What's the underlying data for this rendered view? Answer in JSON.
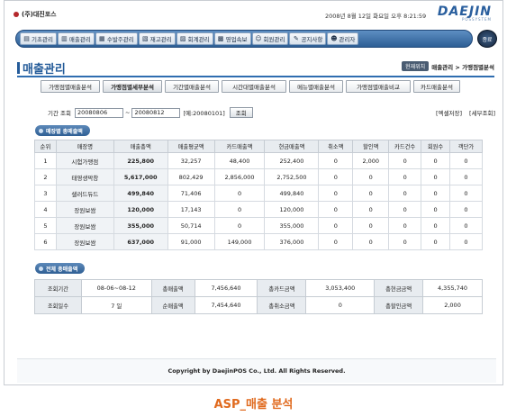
{
  "header": {
    "company": "(주)대진포스",
    "datetime": "2008년 8월 12일 화요일 오후 8:21:59",
    "logo_text": "DAEJIN",
    "logo_sub": "POSSYSTEM"
  },
  "nav": {
    "items": [
      {
        "label": "기초관리",
        "icon": "folder-icon",
        "glyph": "▤"
      },
      {
        "label": "매출관리",
        "icon": "chart-icon",
        "glyph": "▥"
      },
      {
        "label": "수발주관리",
        "icon": "truck-icon",
        "glyph": "▦"
      },
      {
        "label": "재고관리",
        "icon": "box-icon",
        "glyph": "▧"
      },
      {
        "label": "회계관리",
        "icon": "calculator-icon",
        "glyph": "▨"
      },
      {
        "label": "영업속보",
        "icon": "news-icon",
        "glyph": "▩"
      },
      {
        "label": "회원관리",
        "icon": "users-icon",
        "glyph": "☺"
      },
      {
        "label": "공지사항",
        "icon": "megaphone-icon",
        "glyph": "✎"
      },
      {
        "label": "관리자",
        "icon": "admin-icon",
        "glyph": "☻"
      }
    ],
    "logout": "종료"
  },
  "page": {
    "title": "매출관리",
    "location_badge": "현재위치",
    "location_path": "매출관리 > 가맹점별분석"
  },
  "tabs": [
    {
      "label": "가맹점별매출분석"
    },
    {
      "label": "가맹점별세부분석"
    },
    {
      "label": "기간별매출분석"
    },
    {
      "label": "시간대별매출분석"
    },
    {
      "label": "메뉴별매출분석"
    },
    {
      "label": "가맹점별매출비교"
    },
    {
      "label": "카드매출분석"
    }
  ],
  "search": {
    "label": "기간 조회",
    "start_date": "20080806",
    "tilde": "~",
    "end_date": "20080812",
    "hint": "[예:20080101]",
    "button": "조회",
    "excel_link": "[엑셀저장]",
    "detail_link": "[세부조회]"
  },
  "store_section": {
    "heading": "매장별 총매출액",
    "columns": [
      "순위",
      "매장명",
      "매출총액",
      "매출평균액",
      "카드매출액",
      "현금매출액",
      "취소액",
      "할인액",
      "카드건수",
      "회원수",
      "객단가"
    ],
    "rows": [
      [
        "1",
        "시험가맹점",
        "225,800",
        "32,257",
        "48,400",
        "252,400",
        "0",
        "2,000",
        "0",
        "0",
        "0"
      ],
      [
        "2",
        "태영생막창",
        "5,617,000",
        "802,429",
        "2,856,000",
        "2,752,500",
        "0",
        "0",
        "0",
        "0",
        "0"
      ],
      [
        "3",
        "샐러드듀드",
        "499,840",
        "71,406",
        "0",
        "499,840",
        "0",
        "0",
        "0",
        "0",
        "0"
      ],
      [
        "4",
        "장원보쌈",
        "120,000",
        "17,143",
        "0",
        "120,000",
        "0",
        "0",
        "0",
        "0",
        "0"
      ],
      [
        "5",
        "장원보쌈",
        "355,000",
        "50,714",
        "0",
        "355,000",
        "0",
        "0",
        "0",
        "0",
        "0"
      ],
      [
        "6",
        "장원보쌈",
        "637,000",
        "91,000",
        "149,000",
        "376,000",
        "0",
        "0",
        "0",
        "0",
        "0"
      ]
    ]
  },
  "total_section": {
    "heading": "전체 총매출액",
    "rows": [
      [
        "조회기간",
        "08-06~08-12",
        "총매출액",
        "7,456,640",
        "총카드금액",
        "3,053,400",
        "총현금금액",
        "4,355,740"
      ],
      [
        "조회일수",
        "7 일",
        "순매출액",
        "7,454,640",
        "총취소금액",
        "0",
        "총할인금액",
        "2,000"
      ]
    ]
  },
  "footer": {
    "copyright": "Copyright by DaejinPOS Co., Ltd. All Rights Reserved."
  },
  "caption": "ASP_매출 분석",
  "colors": {
    "brand": "#245b99",
    "nav_bg": "#2d5e95",
    "caption": "#e06a1e"
  }
}
